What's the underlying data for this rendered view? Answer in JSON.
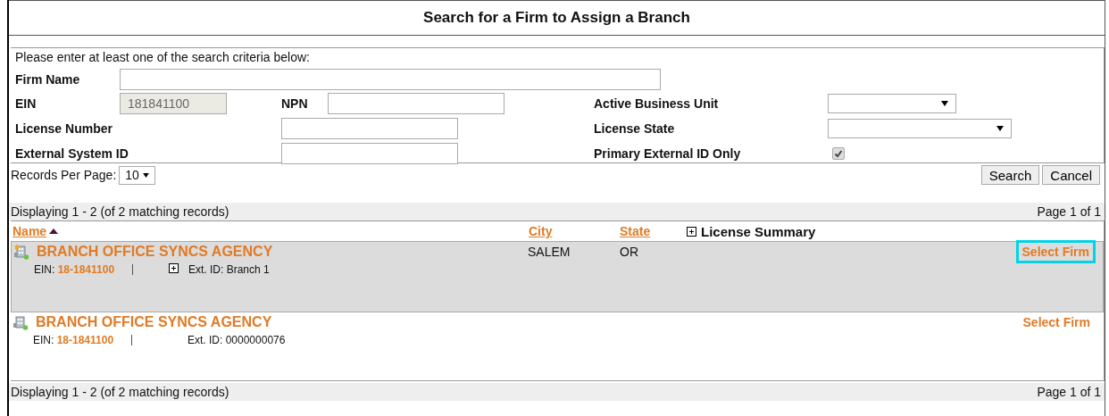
{
  "window": {
    "title": "Search for a Firm to Assign a Branch"
  },
  "criteria": {
    "instruction": "Please enter at least one of the search criteria below:",
    "firm_name": {
      "label": "Firm Name"
    },
    "ein": {
      "label": "EIN",
      "value": "181841100",
      "disabled": true
    },
    "npn": {
      "label": "NPN"
    },
    "active_business_unit": {
      "label": "Active Business Unit"
    },
    "license_number": {
      "label": "License Number"
    },
    "license_state": {
      "label": "License State"
    },
    "external_system_id": {
      "label": "External System ID"
    },
    "primary_external_id_only": {
      "label": "Primary External ID Only",
      "checked": true
    }
  },
  "records_per_page": {
    "label": "Records Per Page:",
    "value": "10"
  },
  "buttons": [
    "Search",
    "Cancel"
  ],
  "results": {
    "summary": "Displaying 1 - 2 (of 2 matching records)",
    "page": "Page 1 of 1",
    "columns": [
      {
        "label": "Name",
        "kind": "sortable",
        "sorted": true
      },
      {
        "label": "City",
        "kind": "sortable",
        "sorted": false
      },
      {
        "label": "State",
        "kind": "sortable",
        "sorted": false
      },
      {
        "label": "License Summary",
        "kind": "expandable"
      }
    ],
    "rows": [
      {
        "name": "BRANCH OFFICE SYNCS AGENCY",
        "primary": true,
        "city": "SALEM",
        "state": "OR",
        "ein_label": "EIN:",
        "ein": "18-1841100",
        "ext_id": "Ext. ID: Branch 1",
        "expandable": true,
        "action": "Select Firm",
        "selected": true,
        "highlighted": true
      },
      {
        "name": "BRANCH OFFICE SYNCS AGENCY",
        "primary": false,
        "ein_label": "EIN:",
        "ein": "18-1841100",
        "ext_id": "Ext. ID: 0000000076",
        "expandable": false,
        "action": "Select Firm",
        "selected": false,
        "highlighted": false
      }
    ],
    "footer_summary": "Displaying 1 - 2 (of 2 matching records)",
    "footer_page": "Page 1 of 1"
  }
}
